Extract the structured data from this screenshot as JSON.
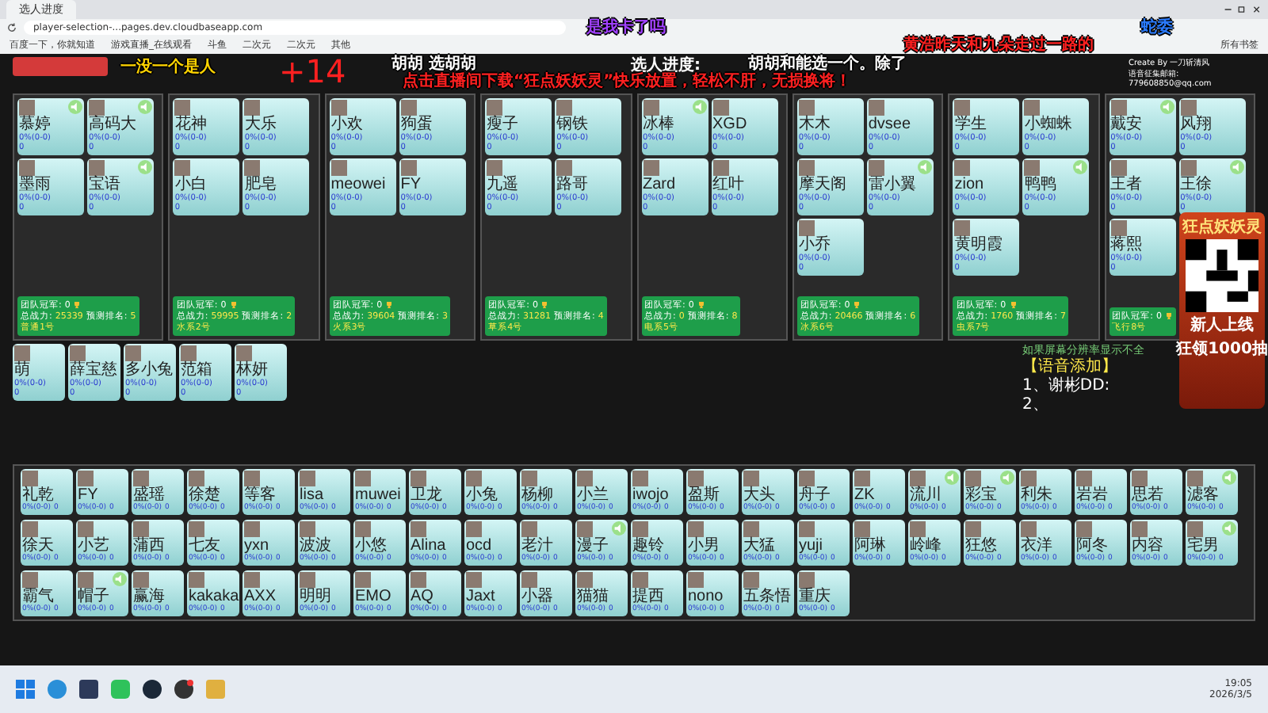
{
  "browser": {
    "tabs": [
      {
        "title": "选人进度",
        "selected": true
      }
    ],
    "address": "player-selection-...pages.dev.cloudbaseapp.com",
    "bookmarks": [
      "百度一下，你就知道",
      "游戏直播_在线观看",
      "斗鱼",
      "二次元",
      "二次元",
      "其他"
    ],
    "all_bookmarks": "所有书签"
  },
  "header": {
    "counter": "+14",
    "progress_label": "选人进度:",
    "credit": "Create By 一刀斩清风",
    "email": "语音征集邮箱: 779608850@qq.com"
  },
  "teams": [
    {
      "name": "普通1号",
      "champion_label": "团队冠军:",
      "champion": "0",
      "power_label": "总战力:",
      "power": "25339",
      "rank_label": "预测排名:",
      "rank": "5",
      "players": [
        {
          "name": "慕婷",
          "record": "0%(0-0)",
          "score": "0",
          "speaking": true
        },
        {
          "name": "高码大",
          "record": "0%(0-0)",
          "score": "0",
          "speaking": true
        },
        {
          "name": "墨雨",
          "record": "0%(0-0)",
          "score": "0",
          "speaking": false
        },
        {
          "name": "宝语",
          "record": "0%(0-0)",
          "score": "0",
          "speaking": true
        }
      ]
    },
    {
      "name": "水系2号",
      "champion_label": "团队冠军:",
      "champion": "0",
      "power_label": "总战力:",
      "power": "59995",
      "rank_label": "预测排名:",
      "rank": "2",
      "players": [
        {
          "name": "花神",
          "record": "0%(0-0)",
          "score": "0",
          "speaking": false
        },
        {
          "name": "大乐",
          "record": "0%(0-0)",
          "score": "0",
          "speaking": false
        },
        {
          "name": "小白",
          "record": "0%(0-0)",
          "score": "0",
          "speaking": false
        },
        {
          "name": "肥皂",
          "record": "0%(0-0)",
          "score": "0",
          "speaking": false
        }
      ]
    },
    {
      "name": "火系3号",
      "champion_label": "团队冠军:",
      "champion": "0",
      "power_label": "总战力:",
      "power": "39604",
      "rank_label": "预测排名:",
      "rank": "3",
      "players": [
        {
          "name": "小欢",
          "record": "0%(0-0)",
          "score": "0",
          "speaking": false
        },
        {
          "name": "狗蛋",
          "record": "0%(0-0)",
          "score": "0",
          "speaking": false
        },
        {
          "name": "meowei",
          "record": "0%(0-0)",
          "score": "0",
          "speaking": false
        },
        {
          "name": "FY",
          "record": "0%(0-0)",
          "score": "0",
          "speaking": false
        }
      ]
    },
    {
      "name": "草系4号",
      "champion_label": "团队冠军:",
      "champion": "0",
      "power_label": "总战力:",
      "power": "31281",
      "rank_label": "预测排名:",
      "rank": "4",
      "players": [
        {
          "name": "瘦子",
          "record": "0%(0-0)",
          "score": "0",
          "speaking": false
        },
        {
          "name": "钢铁",
          "record": "0%(0-0)",
          "score": "0",
          "speaking": false
        },
        {
          "name": "九遥",
          "record": "0%(0-0)",
          "score": "0",
          "speaking": false
        },
        {
          "name": "路哥",
          "record": "0%(0-0)",
          "score": "0",
          "speaking": false
        }
      ]
    },
    {
      "name": "电系5号",
      "champion_label": "团队冠军:",
      "champion": "0",
      "power_label": "总战力:",
      "power": "0",
      "rank_label": "预测排名:",
      "rank": "8",
      "players": [
        {
          "name": "冰棒",
          "record": "0%(0-0)",
          "score": "0",
          "speaking": true
        },
        {
          "name": "XGD",
          "record": "0%(0-0)",
          "score": "0",
          "speaking": false
        },
        {
          "name": "Zard",
          "record": "0%(0-0)",
          "score": "0",
          "speaking": false
        },
        {
          "name": "红叶",
          "record": "0%(0-0)",
          "score": "0",
          "speaking": false
        }
      ]
    },
    {
      "name": "冰系6号",
      "champion_label": "团队冠军:",
      "champion": "0",
      "power_label": "总战力:",
      "power": "20466",
      "rank_label": "预测排名:",
      "rank": "6",
      "players": [
        {
          "name": "木木",
          "record": "0%(0-0)",
          "score": "0",
          "speaking": false
        },
        {
          "name": "dvsee",
          "record": "0%(0-0)",
          "score": "0",
          "speaking": false
        },
        {
          "name": "摩天阁",
          "record": "0%(0-0)",
          "score": "0",
          "speaking": false
        },
        {
          "name": "雷小翼",
          "record": "0%(0-0)",
          "score": "0",
          "speaking": true
        },
        {
          "name": "小乔",
          "record": "0%(0-0)",
          "score": "0",
          "speaking": false
        }
      ]
    },
    {
      "name": "虫系7号",
      "champion_label": "团队冠军:",
      "champion": "0",
      "power_label": "总战力:",
      "power": "1760",
      "rank_label": "预测排名:",
      "rank": "7",
      "players": [
        {
          "name": "学生",
          "record": "0%(0-0)",
          "score": "0",
          "speaking": false
        },
        {
          "name": "小蜘蛛",
          "record": "0%(0-0)",
          "score": "0",
          "speaking": false
        },
        {
          "name": "zion",
          "record": "0%(0-0)",
          "score": "0",
          "speaking": false
        },
        {
          "name": "鸭鸭",
          "record": "0%(0-0)",
          "score": "0",
          "speaking": true
        },
        {
          "name": "黄明霞",
          "record": "0%(0-0)",
          "score": "0",
          "speaking": false
        }
      ]
    },
    {
      "name": "飞行8号",
      "champion_label": "团队冠军:",
      "champion": "0",
      "players": [
        {
          "name": "戴安",
          "record": "0%(0-0)",
          "score": "0",
          "speaking": true
        },
        {
          "name": "风翔",
          "record": "0%(0-0)",
          "score": "0",
          "speaking": false
        },
        {
          "name": "王者",
          "record": "0%(0-0)",
          "score": "0",
          "speaking": false
        },
        {
          "name": "王徐",
          "record": "0%(0-0)",
          "score": "0",
          "speaking": true
        },
        {
          "name": "蒋熙",
          "record": "0%(0-0)",
          "score": "0",
          "speaking": false
        }
      ]
    }
  ],
  "pool": [
    {
      "name": "萌",
      "record": "0%(0-0)",
      "score": "0",
      "speaking": false
    },
    {
      "name": "薛宝慈",
      "record": "0%(0-0)",
      "score": "0",
      "speaking": false
    },
    {
      "name": "多小兔",
      "record": "0%(0-0)",
      "score": "0",
      "speaking": false
    },
    {
      "name": "范箱",
      "record": "0%(0-0)",
      "score": "0",
      "speaking": false
    },
    {
      "name": "林妍",
      "record": "0%(0-0)",
      "score": "0",
      "speaking": false
    }
  ],
  "side_notes": {
    "hint": "如果屏幕分辨率显示不全",
    "voice_title": "【语音添加】",
    "items": [
      "1、谢彬DD:",
      "2、"
    ]
  },
  "bench": [
    [
      {
        "name": "礼乾",
        "record": "0%(0-0)",
        "score": "0",
        "speaking": false
      },
      {
        "name": "FY",
        "record": "0%(0-0)",
        "score": "0",
        "speaking": false
      },
      {
        "name": "盛瑶",
        "record": "0%(0-0)",
        "score": "0",
        "speaking": false
      },
      {
        "name": "徐楚",
        "record": "0%(0-0)",
        "score": "0",
        "speaking": false
      },
      {
        "name": "等客",
        "record": "0%(0-0)",
        "score": "0",
        "speaking": false
      },
      {
        "name": "lisa",
        "record": "0%(0-0)",
        "score": "0",
        "speaking": false
      },
      {
        "name": "muwei",
        "record": "0%(0-0)",
        "score": "0",
        "speaking": false
      },
      {
        "name": "卫龙",
        "record": "0%(0-0)",
        "score": "0",
        "speaking": false
      },
      {
        "name": "小兔",
        "record": "0%(0-0)",
        "score": "0",
        "speaking": false
      },
      {
        "name": "杨柳",
        "record": "0%(0-0)",
        "score": "0",
        "speaking": false
      },
      {
        "name": "小兰",
        "record": "0%(0-0)",
        "score": "0",
        "speaking": false
      },
      {
        "name": "iwojo",
        "record": "0%(0-0)",
        "score": "0",
        "speaking": false
      },
      {
        "name": "盈斯",
        "record": "0%(0-0)",
        "score": "0",
        "speaking": false
      },
      {
        "name": "大头",
        "record": "0%(0-0)",
        "score": "0",
        "speaking": false
      },
      {
        "name": "舟子",
        "record": "0%(0-0)",
        "score": "0",
        "speaking": false
      },
      {
        "name": "ZK",
        "record": "0%(0-0)",
        "score": "0",
        "speaking": false
      },
      {
        "name": "流川",
        "record": "0%(0-0)",
        "score": "0",
        "speaking": true
      },
      {
        "name": "彩宝",
        "record": "0%(0-0)",
        "score": "0",
        "speaking": true
      },
      {
        "name": "利朱",
        "record": "0%(0-0)",
        "score": "0",
        "speaking": false
      },
      {
        "name": "岩岩",
        "record": "0%(0-0)",
        "score": "0",
        "speaking": false
      },
      {
        "name": "思若",
        "record": "0%(0-0)",
        "score": "0",
        "speaking": false
      },
      {
        "name": "滤客",
        "record": "0%(0-0)",
        "score": "0",
        "speaking": true
      }
    ],
    [
      {
        "name": "徐天",
        "record": "0%(0-0)",
        "score": "0",
        "speaking": false
      },
      {
        "name": "小艺",
        "record": "0%(0-0)",
        "score": "0",
        "speaking": false
      },
      {
        "name": "蒲西",
        "record": "0%(0-0)",
        "score": "0",
        "speaking": false
      },
      {
        "name": "七友",
        "record": "0%(0-0)",
        "score": "0",
        "speaking": false
      },
      {
        "name": "yxn",
        "record": "0%(0-0)",
        "score": "0",
        "speaking": false
      },
      {
        "name": "波波",
        "record": "0%(0-0)",
        "score": "0",
        "speaking": false
      },
      {
        "name": "小悠",
        "record": "0%(0-0)",
        "score": "0",
        "speaking": false
      },
      {
        "name": "Alina",
        "record": "0%(0-0)",
        "score": "0",
        "speaking": false
      },
      {
        "name": "ocd",
        "record": "0%(0-0)",
        "score": "0",
        "speaking": false
      },
      {
        "name": "老汁",
        "record": "0%(0-0)",
        "score": "0",
        "speaking": false
      },
      {
        "name": "漫子",
        "record": "0%(0-0)",
        "score": "0",
        "speaking": true
      },
      {
        "name": "趣铃",
        "record": "0%(0-0)",
        "score": "0",
        "speaking": false
      },
      {
        "name": "小男",
        "record": "0%(0-0)",
        "score": "0",
        "speaking": false
      },
      {
        "name": "大猛",
        "record": "0%(0-0)",
        "score": "0",
        "speaking": false
      },
      {
        "name": "yuji",
        "record": "0%(0-0)",
        "score": "0",
        "speaking": false
      },
      {
        "name": "阿琳",
        "record": "0%(0-0)",
        "score": "0",
        "speaking": false
      },
      {
        "name": "岭峰",
        "record": "0%(0-0)",
        "score": "0",
        "speaking": false
      },
      {
        "name": "狂悠",
        "record": "0%(0-0)",
        "score": "0",
        "speaking": false
      },
      {
        "name": "衣洋",
        "record": "0%(0-0)",
        "score": "0",
        "speaking": false
      },
      {
        "name": "阿冬",
        "record": "0%(0-0)",
        "score": "0",
        "speaking": false
      },
      {
        "name": "内容",
        "record": "0%(0-0)",
        "score": "0",
        "speaking": false
      },
      {
        "name": "宅男",
        "record": "0%(0-0)",
        "score": "0",
        "speaking": true
      }
    ],
    [
      {
        "name": "霸气",
        "record": "0%(0-0)",
        "score": "0",
        "speaking": false
      },
      {
        "name": "帽子",
        "record": "0%(0-0)",
        "score": "0",
        "speaking": true
      },
      {
        "name": "赢海",
        "record": "0%(0-0)",
        "score": "0",
        "speaking": false
      },
      {
        "name": "kakaka",
        "record": "0%(0-0)",
        "score": "0",
        "speaking": false
      },
      {
        "name": "AXX",
        "record": "0%(0-0)",
        "score": "0",
        "speaking": false
      },
      {
        "name": "明明",
        "record": "0%(0-0)",
        "score": "0",
        "speaking": false
      },
      {
        "name": "EMO",
        "record": "0%(0-0)",
        "score": "0",
        "speaking": false
      },
      {
        "name": "AQ",
        "record": "0%(0-0)",
        "score": "0",
        "speaking": false
      },
      {
        "name": "Jaxt",
        "record": "0%(0-0)",
        "score": "0",
        "speaking": false
      },
      {
        "name": "小器",
        "record": "0%(0-0)",
        "score": "0",
        "speaking": false
      },
      {
        "name": "猫猫",
        "record": "0%(0-0)",
        "score": "0",
        "speaking": false
      },
      {
        "name": "提西",
        "record": "0%(0-0)",
        "score": "0",
        "speaking": false
      },
      {
        "name": "nono",
        "record": "0%(0-0)",
        "score": "0",
        "speaking": false
      },
      {
        "name": "五条悟",
        "record": "0%(0-0)",
        "score": "0",
        "speaking": false
      },
      {
        "name": "重庆",
        "record": "0%(0-0)",
        "score": "0",
        "speaking": false
      }
    ]
  ],
  "ad": {
    "title": "狂点妖妖灵",
    "line_1": "新人上线",
    "line_2": "狂领1000抽"
  },
  "danmaku": [
    {
      "text": "一没一个是人",
      "color": "#ffd400"
    },
    {
      "text": "是我卡了吗",
      "color": "#a040ff"
    },
    {
      "text": "胡胡 选胡胡",
      "color": "#ffffff"
    },
    {
      "text": "胡胡和能选一个。除了",
      "color": "#ffffff"
    },
    {
      "text": "黄浩昨天和九朵走过一路的",
      "color": "#ff2020"
    },
    {
      "text": "点击直播间下载“狂点妖妖灵”快乐放置，轻松不肝，无损换将！",
      "color": "#ff2020"
    },
    {
      "text": "蛇委",
      "color": "#2a7bff"
    }
  ],
  "taskbar": {
    "time": "19:05",
    "date": "2026/3/5"
  }
}
